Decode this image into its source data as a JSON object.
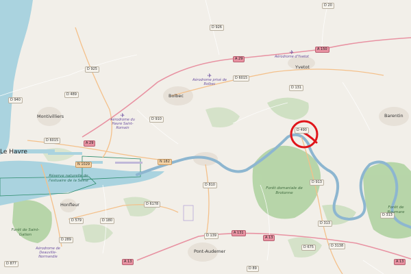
{
  "map": {
    "towns": {
      "le_havre": "Le Havre",
      "montivilliers": "Montivilliers",
      "bolbec": "Bolbec",
      "yvetot": "Yvetot",
      "barentin": "Barentin",
      "honfleur": "Honfleur",
      "pont_audemer": "Pont-Audemer"
    },
    "roads": {
      "d926": "D 926",
      "d20": "D 20",
      "a150": "A 150",
      "a29_n": "A 29",
      "d925": "D 925",
      "d489": "D 489",
      "d940": "D 940",
      "d6015_w": "D 6015",
      "a29_w": "A 29",
      "n1029": "N 1029",
      "d6015_c": "D 6015",
      "d131": "D 131",
      "d910": "D 910",
      "n182": "N 182",
      "d490": "D 490",
      "d810": "D 810",
      "d913_a": "D 913",
      "d6178": "D 6178",
      "d579": "D 579",
      "d180": "D 180",
      "d289": "D 289",
      "d139": "D 139",
      "a131": "A 131",
      "a13_c": "A 13",
      "d675": "D 675",
      "d313": "D 313",
      "d313b": "D 313",
      "d3138": "D 3138",
      "d89": "D 89",
      "a13_s": "A 13",
      "a13_e": "A 13",
      "d877": "D 877"
    },
    "forests": {
      "brotonne": "Forêt domaniale de Brotonne",
      "roumare": "Forêt de Roumare",
      "st_gatien": "Forêt de Saint-Gatien",
      "deauville": "Aérodrome de Deauville-Normandie"
    },
    "aerodromes": {
      "yvetot": "Aérodrome d'Yvetot",
      "bolbec": "Aérodrome privé de Bolbec",
      "havre": "Aérodrome du Havre Saint-Romain"
    },
    "reserve": "Réserve naturelle de l'estuaire de la Seine",
    "marker_color": "#e0151b",
    "colors": {
      "water": "#aad3df",
      "forest": "#add19e",
      "land": "#f2efe9",
      "river": "#8db6d0"
    }
  }
}
